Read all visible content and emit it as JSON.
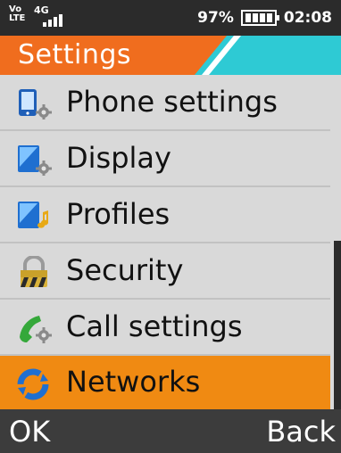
{
  "status_bar": {
    "volte_line1": "Vo",
    "volte_line2": "LTE",
    "network_type": "4G",
    "battery_percent": "97%",
    "battery_level": 1.0,
    "time": "02:08"
  },
  "header": {
    "title": "Settings",
    "accent_color": "#f06d1e",
    "secondary_color": "#2ecad4"
  },
  "menu": {
    "selected_color": "#f08a12",
    "items": [
      {
        "label": "Phone settings",
        "icon": "phone-settings-icon",
        "selected": false
      },
      {
        "label": "Display",
        "icon": "display-icon",
        "selected": false
      },
      {
        "label": "Profiles",
        "icon": "profiles-icon",
        "selected": false
      },
      {
        "label": "Security",
        "icon": "padlock-icon",
        "selected": false
      },
      {
        "label": "Call settings",
        "icon": "call-settings-icon",
        "selected": false
      },
      {
        "label": "Networks",
        "icon": "networks-icon",
        "selected": true
      }
    ]
  },
  "softkeys": {
    "left": "OK",
    "right": "Back"
  }
}
